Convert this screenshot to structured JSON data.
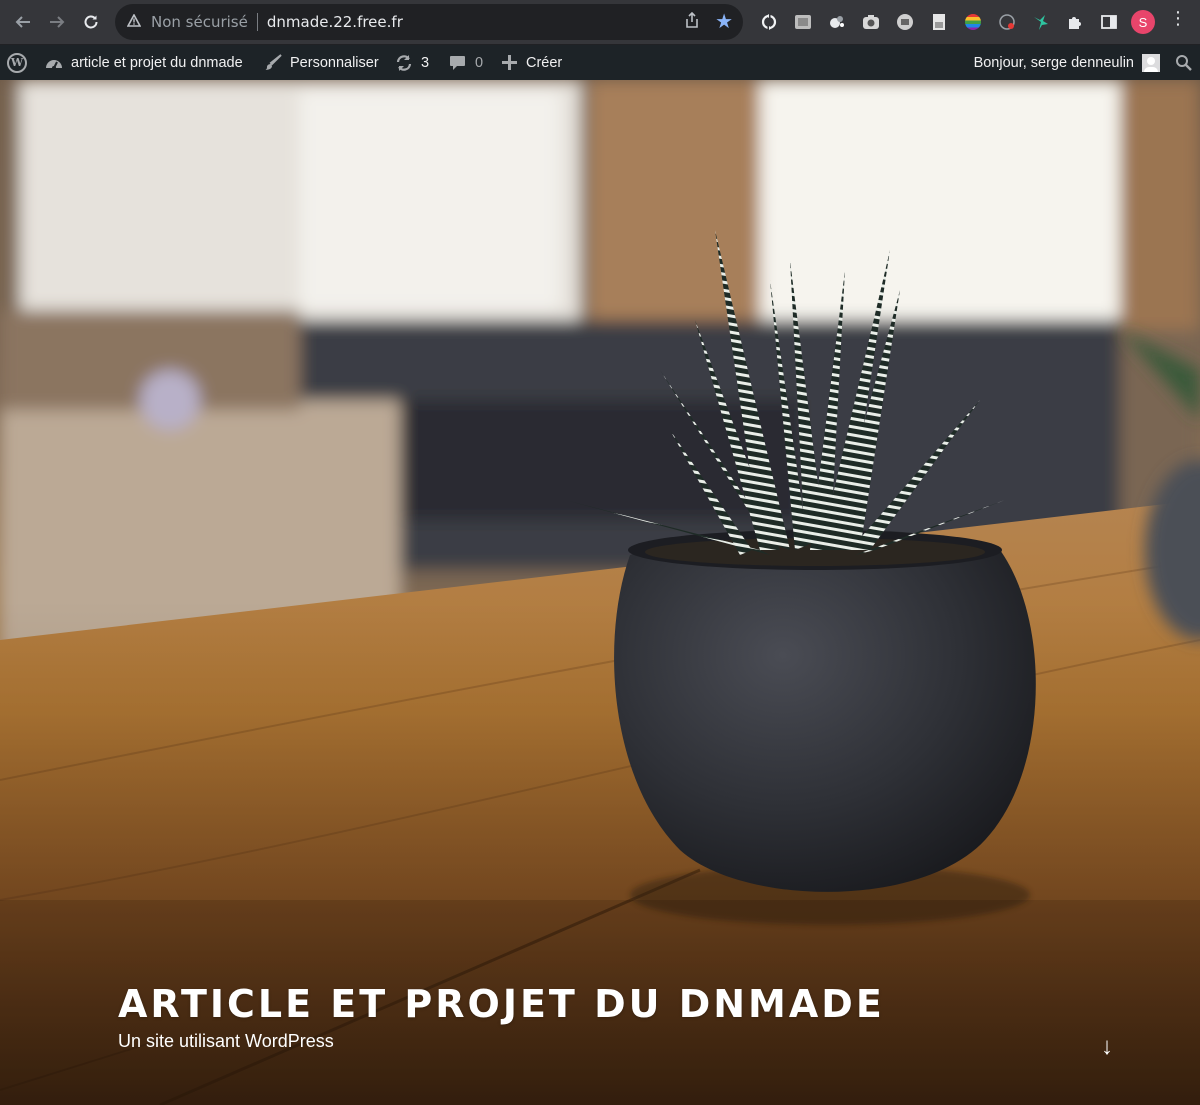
{
  "browser": {
    "security_label": "Non sécurisé",
    "url": "dnmade.22.free.fr",
    "profile_initial": "S",
    "icons": {
      "back": "arrow-left-icon",
      "forward": "arrow-right-icon",
      "reload": "reload-icon",
      "warning": "warning-triangle-icon",
      "share": "share-icon",
      "bookmark": "star-icon",
      "menu": "more-vertical-icon"
    },
    "extensions": [
      "sync-extension-icon",
      "screenshot-extension-icon",
      "dots-extension-icon",
      "camera-extension-icon",
      "print-extension-icon",
      "page-extension-icon",
      "color-extension-icon",
      "web-extension-icon",
      "bird-extension-icon",
      "puzzle-icon",
      "sidepanel-icon"
    ],
    "accent_color": "#8ab4f8",
    "profile_color": "#e8456b"
  },
  "admin_bar": {
    "site_name": "article et projet du dnmade",
    "customize": "Personnaliser",
    "updates_count": "3",
    "comments_count": "0",
    "new_label": "Créer",
    "greeting": "Bonjour, serge denneulin"
  },
  "hero": {
    "title": "ARTICLE ET PROJET DU DNMADE",
    "tagline": "Un site utilisant WordPress",
    "scroll_arrow": "↓"
  }
}
